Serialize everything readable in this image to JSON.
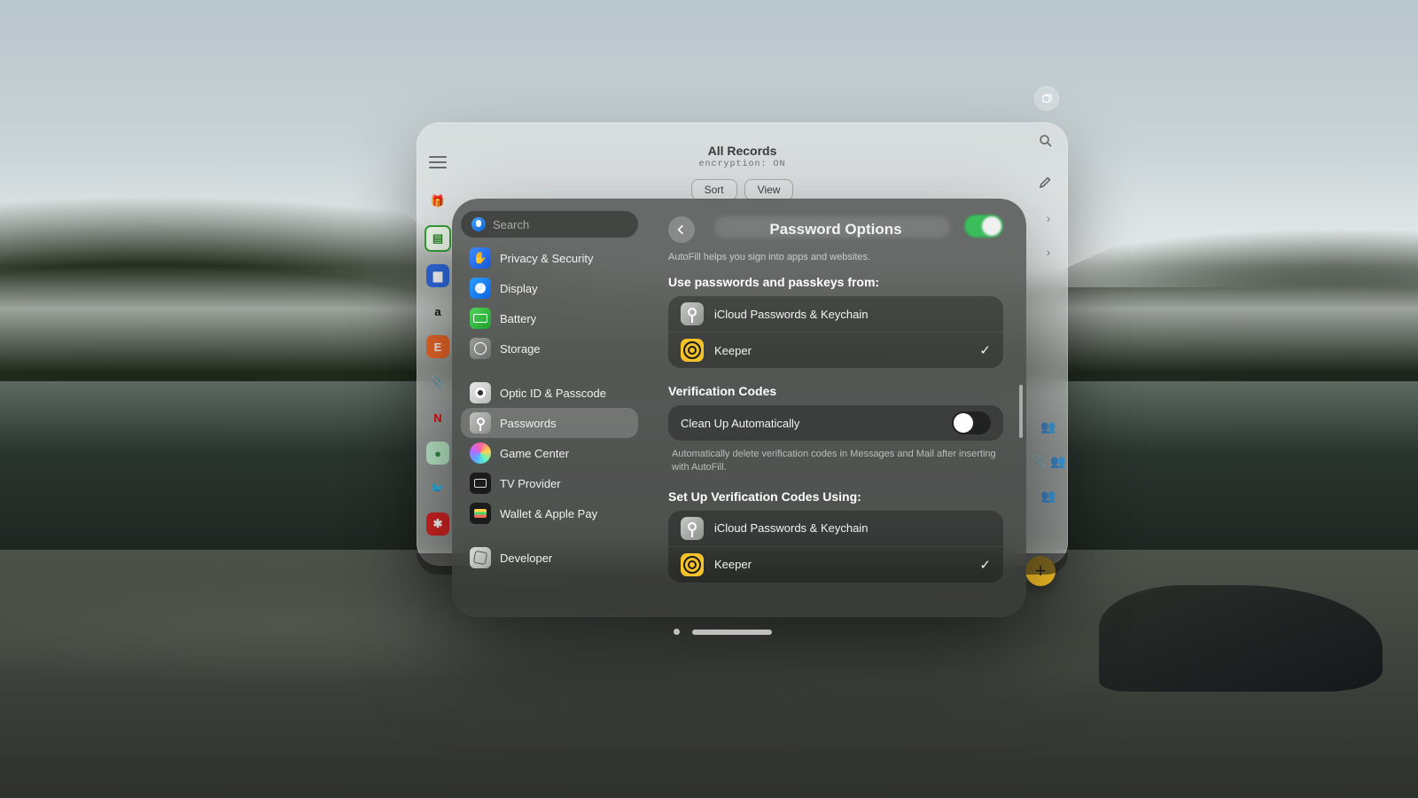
{
  "background_app": {
    "title": "All Records",
    "subtitle": "encryption: ON",
    "buttons": {
      "sort": "Sort",
      "view": "View"
    },
    "add_label": "+",
    "rail": [
      {
        "name": "gift-icon",
        "glyph": "🎁",
        "bg": "transparent",
        "fg": "#6a6b6a"
      },
      {
        "name": "green-card-icon",
        "glyph": "▤",
        "bg": "#d6f3cf",
        "fg": "#2f8a2a"
      },
      {
        "name": "blue-folder-icon",
        "glyph": "▆",
        "bg": "#2f6adf",
        "fg": "#ffffff"
      },
      {
        "name": "amazon-icon",
        "glyph": "a",
        "bg": "transparent",
        "fg": "#111"
      },
      {
        "name": "etsy-icon",
        "glyph": "E",
        "bg": "#f06a2a",
        "fg": "#ffffff"
      },
      {
        "name": "attachment-icon",
        "glyph": "📎",
        "bg": "transparent",
        "fg": "#6a6b6a"
      },
      {
        "name": "netflix-icon",
        "glyph": "N",
        "bg": "transparent",
        "fg": "#e50914"
      },
      {
        "name": "green-circle-icon",
        "glyph": "●",
        "bg": "#bdeccb",
        "fg": "#2e8a46"
      },
      {
        "name": "twitter-icon",
        "glyph": "🐦",
        "bg": "transparent",
        "fg": "#1d9bf0"
      },
      {
        "name": "yelp-icon",
        "glyph": "✱",
        "bg": "#d32323",
        "fg": "#ffffff"
      }
    ]
  },
  "settings": {
    "search_placeholder": "Search",
    "sidebar": [
      {
        "id": "privacy",
        "label": "Privacy & Security",
        "icon": "hand-raised-icon",
        "icon_class": "ico-privacy",
        "glyph": "✋"
      },
      {
        "id": "display",
        "label": "Display",
        "icon": "sun-icon",
        "icon_class": "ico-display",
        "glyph": ""
      },
      {
        "id": "battery",
        "label": "Battery",
        "icon": "battery-icon",
        "icon_class": "ico-battery",
        "glyph": ""
      },
      {
        "id": "storage",
        "label": "Storage",
        "icon": "disk-icon",
        "icon_class": "ico-storage",
        "glyph": ""
      },
      {
        "id": "gap1",
        "gap": true
      },
      {
        "id": "optic",
        "label": "Optic ID & Passcode",
        "icon": "eye-id-icon",
        "icon_class": "ico-optic",
        "glyph": ""
      },
      {
        "id": "passwords",
        "label": "Passwords",
        "icon": "key-icon",
        "icon_class": "ico-passwords",
        "glyph": "",
        "selected": true
      },
      {
        "id": "gamecenter",
        "label": "Game Center",
        "icon": "gamecenter-icon",
        "icon_class": "ico-gamecenter",
        "glyph": ""
      },
      {
        "id": "tv",
        "label": "TV Provider",
        "icon": "tv-icon",
        "icon_class": "ico-tv",
        "glyph": ""
      },
      {
        "id": "wallet",
        "label": "Wallet & Apple Pay",
        "icon": "wallet-icon",
        "icon_class": "ico-wallet",
        "glyph": ""
      },
      {
        "id": "gap2",
        "gap": true
      },
      {
        "id": "developer",
        "label": "Developer",
        "icon": "hammer-icon",
        "icon_class": "ico-dev",
        "glyph": ""
      }
    ],
    "detail": {
      "title": "Password Options",
      "autofill_toggle_on": true,
      "autofill_hint": "AutoFill helps you sign into apps and websites.",
      "section1": {
        "title": "Use passwords and passkeys from:",
        "items": [
          {
            "id": "icloud",
            "label": "iCloud Passwords & Keychain",
            "icon": "key-icon",
            "checked": false
          },
          {
            "id": "keeper",
            "label": "Keeper",
            "icon": "keeper-icon",
            "checked": true
          }
        ]
      },
      "section2": {
        "title": "Verification Codes",
        "row_label": "Clean Up Automatically",
        "row_toggle_on": false,
        "note": "Automatically delete verification codes in Messages and Mail after inserting with AutoFill."
      },
      "section3": {
        "title": "Set Up Verification Codes Using:",
        "items": [
          {
            "id": "icloud2",
            "label": "iCloud Passwords & Keychain",
            "icon": "key-icon",
            "checked": false
          },
          {
            "id": "keeper2",
            "label": "Keeper",
            "icon": "keeper-icon",
            "checked": true
          }
        ]
      }
    }
  }
}
